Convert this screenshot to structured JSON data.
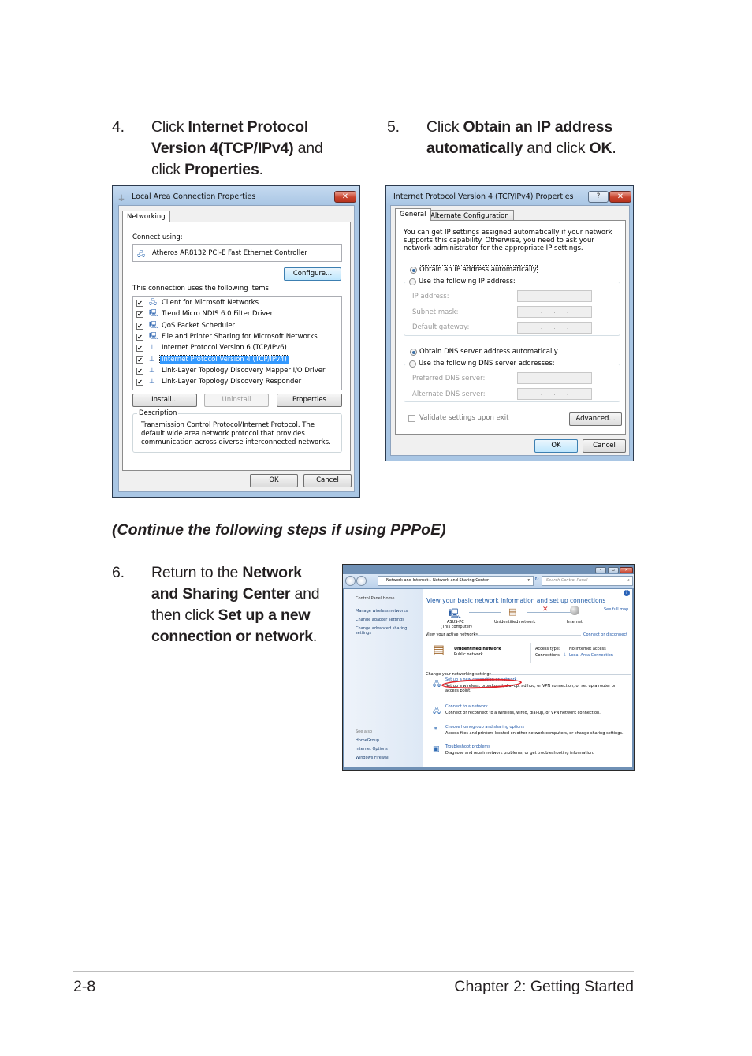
{
  "steps": [
    {
      "number": "4.",
      "lines": [
        {
          "pre": "Click ",
          "bold": "Internet Protocol",
          "post": ""
        },
        {
          "pre": "",
          "bold": "Version 4(TCP/IPv4)",
          "post": " and"
        },
        {
          "pre": "click ",
          "bold": "Properties",
          "post": "."
        }
      ]
    },
    {
      "number": "5.",
      "lines": [
        {
          "pre": "Click ",
          "bold": "Obtain an IP address",
          "post": ""
        },
        {
          "pre": "",
          "bold": "automatically",
          "post": " and click "
        },
        {
          "pre": "",
          "bold": "",
          "post": ""
        }
      ],
      "ok_word": "OK",
      "ok_tail": "."
    },
    {
      "number": "6.",
      "lines": [
        {
          "pre": "Return to the ",
          "bold": "Network",
          "post": ""
        },
        {
          "pre": "",
          "bold": "and Sharing Center",
          "post": " and"
        },
        {
          "pre": "then click ",
          "bold": "Set up a new",
          "post": ""
        },
        {
          "pre": "",
          "bold": "connection or network",
          "post": "."
        }
      ]
    }
  ],
  "note": "(Continue the following steps if using PPPoE)",
  "footer": {
    "page_number": "2-8",
    "chapter": "Chapter 2: Getting Started"
  },
  "lan_dialog": {
    "title": "Local Area Connection Properties",
    "close_glyph": "✕",
    "tab": "Networking",
    "connect_using_label": "Connect using:",
    "adapter": "Atheros AR8132 PCI-E Fast Ethernet Controller",
    "configure_button": "Configure...",
    "items_label": "This connection uses the following items:",
    "items": [
      {
        "label": "Client for Microsoft Networks",
        "checked": true,
        "icon": "network-client-icon",
        "glyph": "🖧",
        "selected": false
      },
      {
        "label": "Trend Micro NDIS 6.0 Filter Driver",
        "checked": true,
        "icon": "service-icon",
        "glyph": "🖳",
        "selected": false
      },
      {
        "label": "QoS Packet Scheduler",
        "checked": true,
        "icon": "service-icon",
        "glyph": "🖳",
        "selected": false
      },
      {
        "label": "File and Printer Sharing for Microsoft Networks",
        "checked": true,
        "icon": "service-icon",
        "glyph": "🖳",
        "selected": false
      },
      {
        "label": "Internet Protocol Version 6 (TCP/IPv6)",
        "checked": true,
        "icon": "protocol-icon",
        "glyph": "⊥",
        "selected": false
      },
      {
        "label": "Internet Protocol Version 4 (TCP/IPv4)",
        "checked": true,
        "icon": "protocol-icon",
        "glyph": "⊥",
        "selected": true
      },
      {
        "label": "Link-Layer Topology Discovery Mapper I/O Driver",
        "checked": true,
        "icon": "protocol-icon",
        "glyph": "⊥",
        "selected": false
      },
      {
        "label": "Link-Layer Topology Discovery Responder",
        "checked": true,
        "icon": "protocol-icon",
        "glyph": "⊥",
        "selected": false
      }
    ],
    "install_button": "Install...",
    "uninstall_button": "Uninstall",
    "properties_button": "Properties",
    "description_label": "Description",
    "description_text": "Transmission Control Protocol/Internet Protocol. The default wide area network protocol that provides communication across diverse interconnected networks.",
    "ok_button": "OK",
    "cancel_button": "Cancel"
  },
  "ipv4_dialog": {
    "title": "Internet Protocol Version 4 (TCP/IPv4) Properties",
    "help_glyph": "?",
    "close_glyph": "✕",
    "tabs": [
      "General",
      "Alternate Configuration"
    ],
    "intro": "You can get IP settings assigned automatically if your network supports this capability. Otherwise, you need to ask your network administrator for the appropriate IP settings.",
    "obtain_ip_auto": "Obtain an IP address automatically",
    "use_following_ip": "Use the following IP address:",
    "ip_address_label": "IP address:",
    "subnet_mask_label": "Subnet mask:",
    "default_gateway_label": "Default gateway:",
    "ip_placeholder": "...",
    "obtain_dns_auto": "Obtain DNS server address automatically",
    "use_following_dns": "Use the following DNS server addresses:",
    "preferred_dns_label": "Preferred DNS server:",
    "alternate_dns_label": "Alternate DNS server:",
    "validate_label": "Validate settings upon exit",
    "advanced_button": "Advanced...",
    "ok_button": "OK",
    "cancel_button": "Cancel",
    "ip_mode": "automatic",
    "dns_mode": "automatic",
    "validate_checked": false
  },
  "nsc_window": {
    "breadcrumb": [
      "Network and Internet",
      "Network and Sharing Center"
    ],
    "search_placeholder": "Search Control Panel",
    "sidebar": {
      "home": "Control Panel Home",
      "links": [
        "Manage wireless networks",
        "Change adapter settings",
        "Change advanced sharing settings"
      ],
      "see_also_label": "See also",
      "see_also": [
        "HomeGroup",
        "Internet Options",
        "Windows Firewall"
      ]
    },
    "heading": "View your basic network information and set up connections",
    "see_full_map": "See full map",
    "map": {
      "computer_name": "ASUS-PC",
      "computer_sub": "(This computer)",
      "network": "Unidentified network",
      "internet": "Internet"
    },
    "active_networks_label": "View your active networks",
    "connect_or_disconnect": "Connect or disconnect",
    "active_network": {
      "name": "Unidentified network",
      "type": "Public network",
      "access_type_label": "Access type:",
      "access_type": "No Internet access",
      "connections_label": "Connections:",
      "connection": "Local Area Connection"
    },
    "change_settings_label": "Change your networking settings",
    "tasks": [
      {
        "title": "Set up a new connection or network",
        "desc": "Set up a wireless, broadband, dial-up, ad hoc, or VPN connection; or set up a router or access point.",
        "icon": "new-connection-icon",
        "highlighted": true
      },
      {
        "title": "Connect to a network",
        "desc": "Connect or reconnect to a wireless, wired, dial-up, or VPN network connection.",
        "icon": "connect-network-icon",
        "highlighted": false
      },
      {
        "title": "Choose homegroup and sharing options",
        "desc": "Access files and printers located on other network computers, or change sharing settings.",
        "icon": "homegroup-icon",
        "highlighted": false
      },
      {
        "title": "Troubleshoot problems",
        "desc": "Diagnose and repair network problems, or get troubleshooting information.",
        "icon": "troubleshoot-icon",
        "highlighted": false
      }
    ]
  },
  "colors": {
    "highlight_circle": "#e0232a",
    "link_blue": "#1e56a8",
    "selection_blue": "#3399ff"
  }
}
